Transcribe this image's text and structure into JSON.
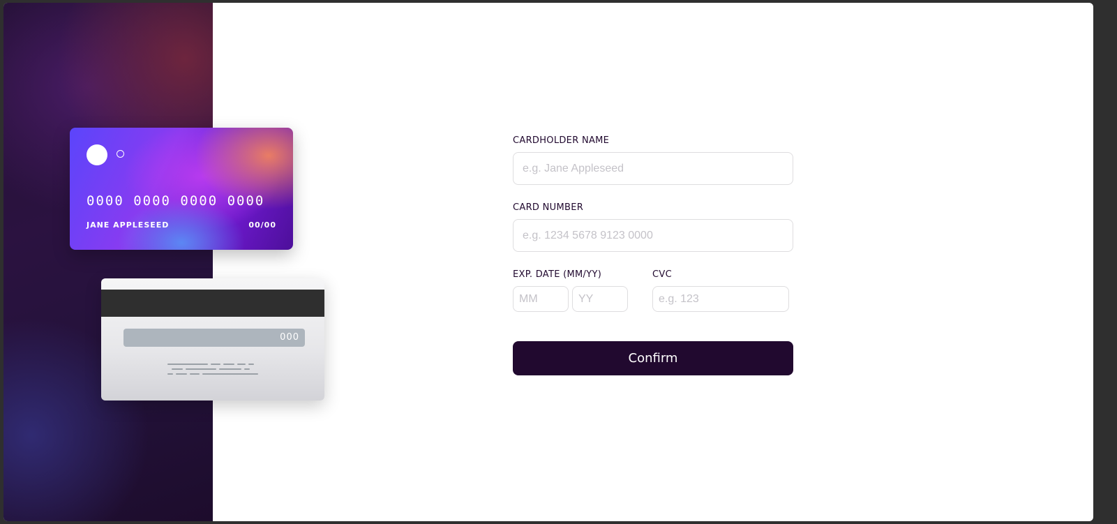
{
  "card_front": {
    "number": "0000 0000 0000 0000",
    "name": "JANE APPLESEED",
    "expiry": "00/00"
  },
  "card_back": {
    "cvc": "000"
  },
  "form": {
    "name_label": "CARDHOLDER NAME",
    "name_placeholder": "e.g. Jane Appleseed",
    "number_label": "CARD NUMBER",
    "number_placeholder": "e.g. 1234 5678 9123 0000",
    "exp_label": "EXP. DATE (MM/YY)",
    "month_placeholder": "MM",
    "year_placeholder": "YY",
    "cvc_label": "CVC",
    "cvc_placeholder": "e.g. 123",
    "confirm_label": "Confirm"
  },
  "colors": {
    "primary_dark": "#21092f",
    "input_border": "#dedddf",
    "placeholder": "#c4c2c8"
  }
}
